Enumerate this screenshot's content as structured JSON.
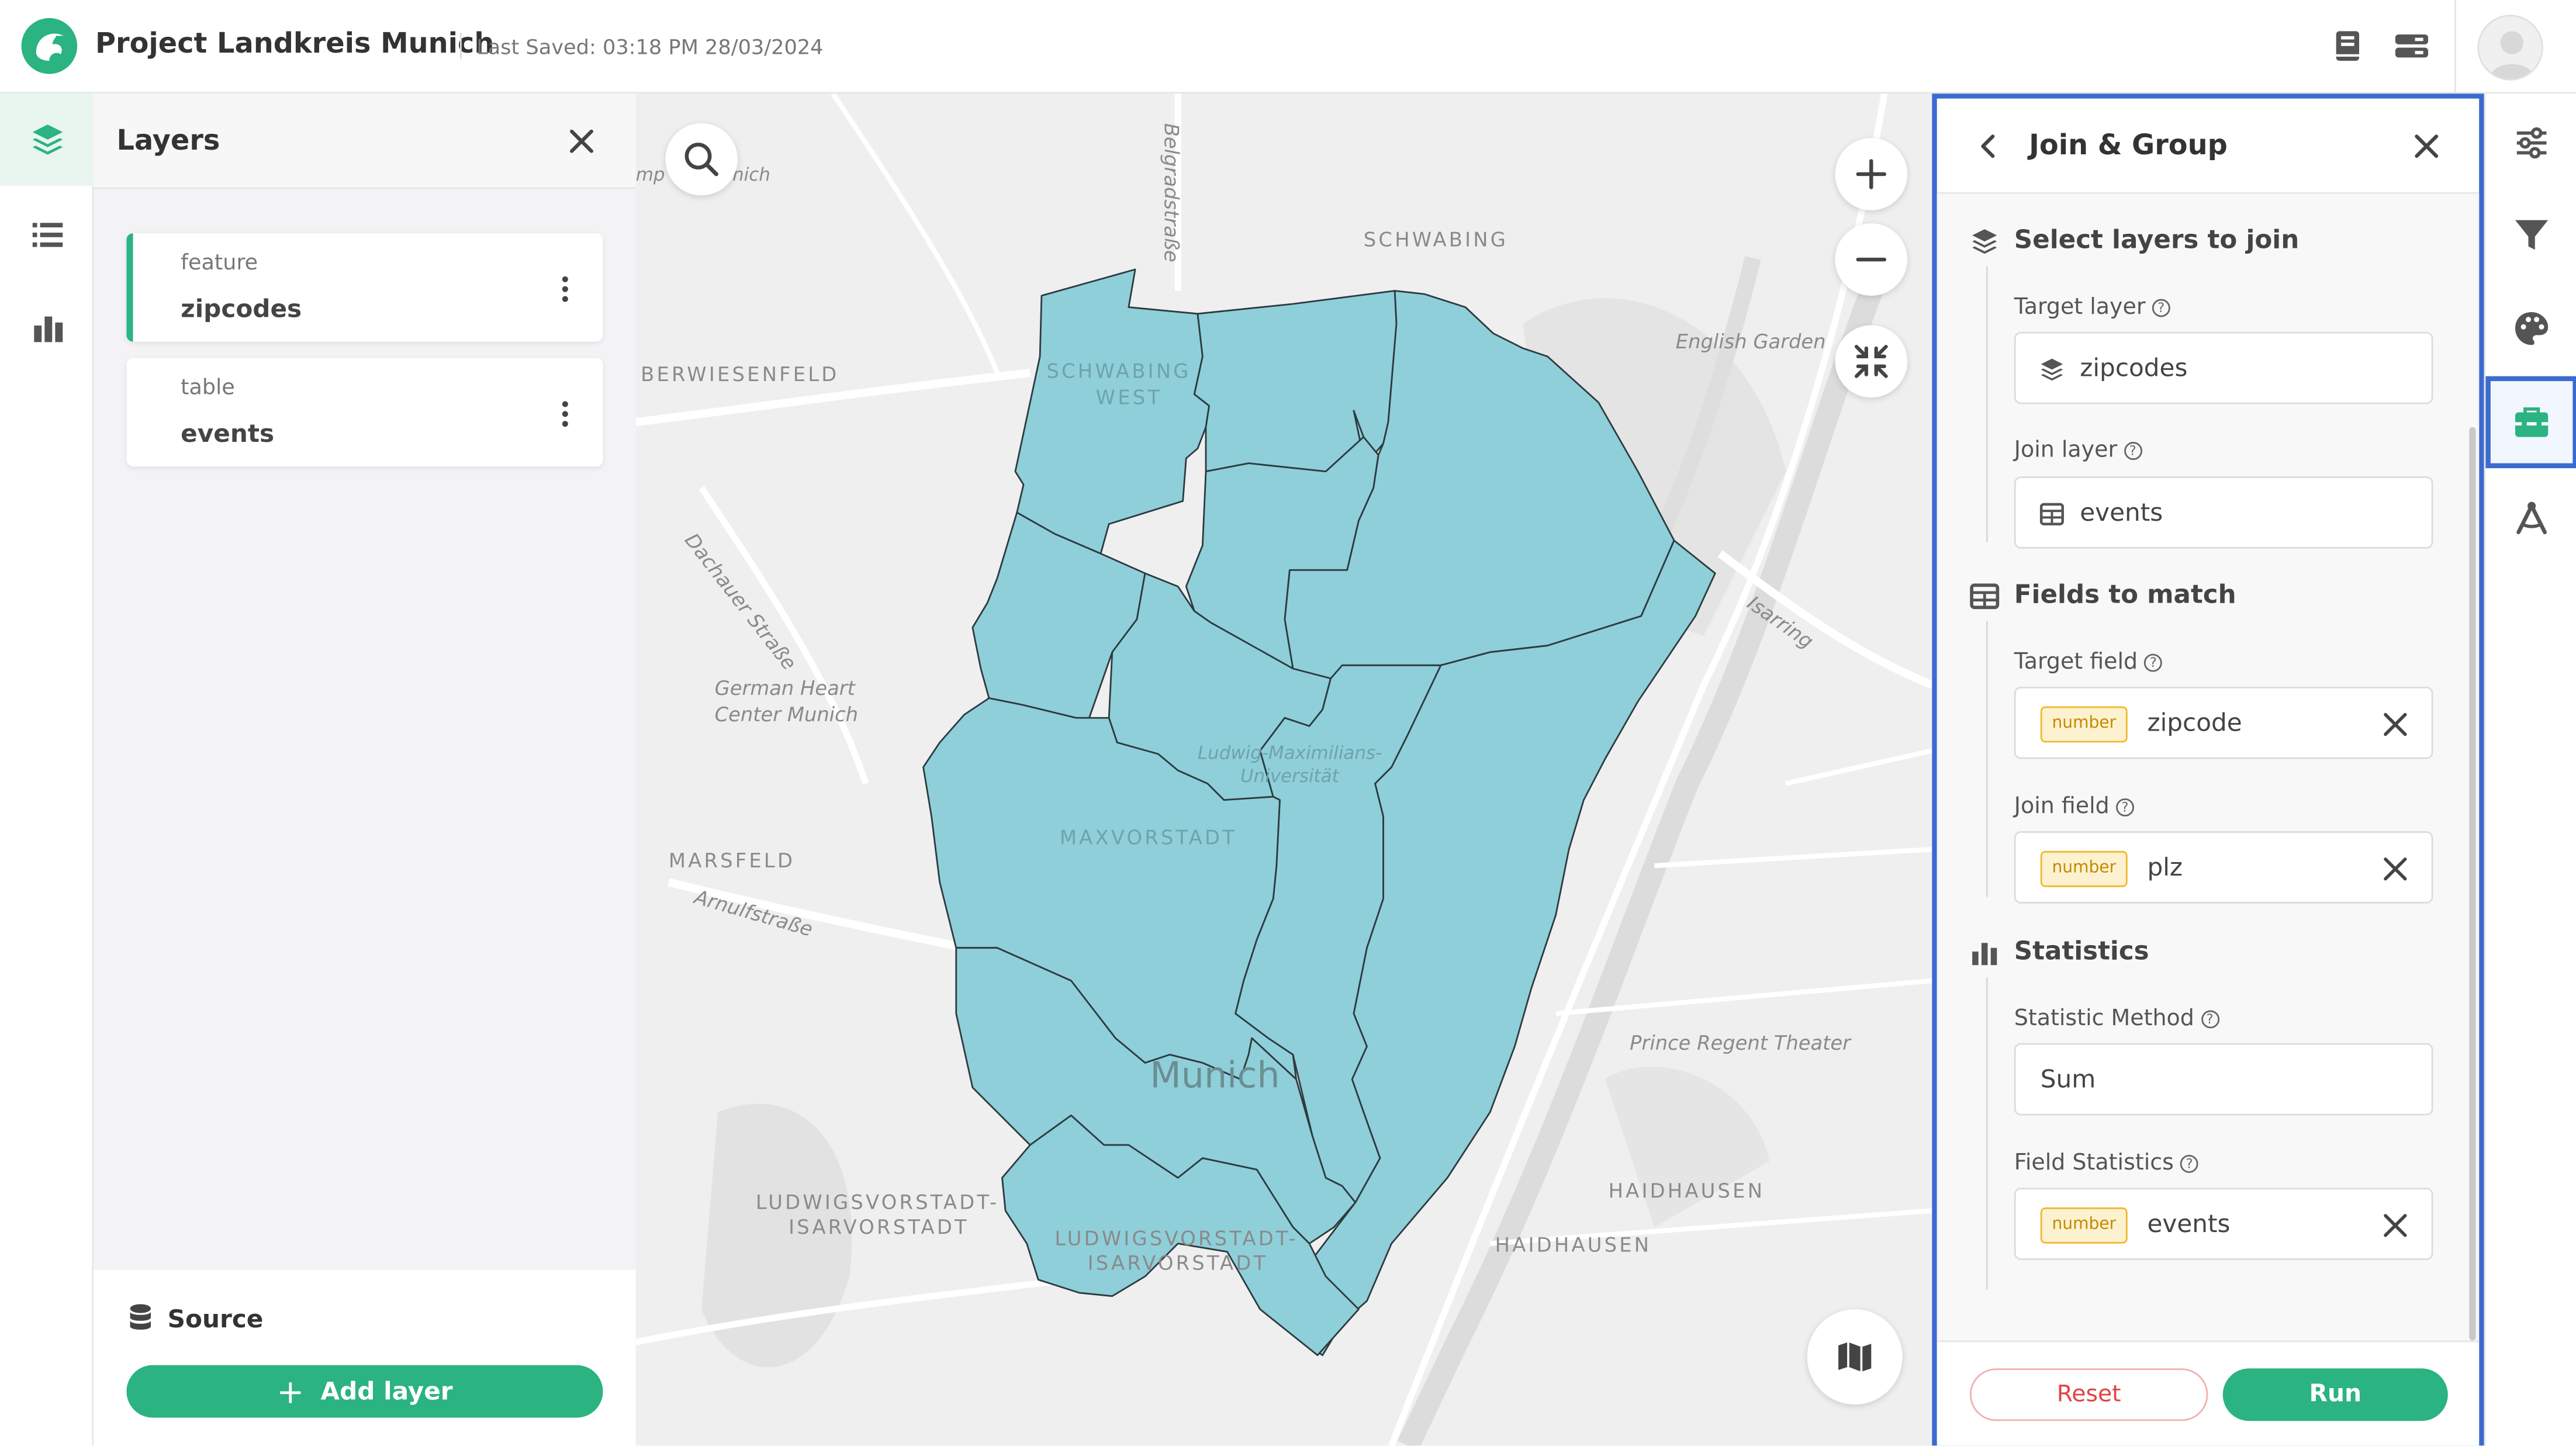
{
  "header": {
    "project_title": "Project Landkreis Munich",
    "last_saved": "Last Saved: 03:18 PM 28/03/2024",
    "icons": [
      "book-icon",
      "data-stack-icon",
      "user-avatar-icon"
    ]
  },
  "left_rail": {
    "items": [
      {
        "icon": "layers-icon",
        "active": true
      },
      {
        "icon": "list-icon",
        "active": false
      },
      {
        "icon": "bar-chart-icon",
        "active": false
      }
    ]
  },
  "layers_panel": {
    "title": "Layers",
    "layers": [
      {
        "type": "feature",
        "name": "zipcodes",
        "selected": true
      },
      {
        "type": "table",
        "name": "events",
        "selected": false
      }
    ],
    "source_label": "Source",
    "add_layer_label": "Add layer"
  },
  "map": {
    "labels": {
      "schwabing": "SCHWABING",
      "schwabing_west_1": "SCHWABING",
      "schwabing_west_2": "WEST",
      "berwiesenfeld": "BERWIESENFELD",
      "english_garden": "English Garden",
      "dachauer": "Dachauer Straße",
      "isarring": "Isarring",
      "belgradstrasse": "Belgradstraße",
      "german_heart_1": "German Heart",
      "german_heart_2": "Center Munich",
      "lmu_1": "Ludwig-Maximilians-",
      "lmu_2": "Universität",
      "maxvorstadt": "MAXVORSTADT",
      "marsfeld": "MARSFELD",
      "arnulfstrasse": "Arnulfstraße",
      "munich": "Munich",
      "prince_regent": "Prince Regent Theater",
      "haidhausen_1": "HAIDHAUSEN",
      "haidhausen_2": "HAIDHAUSEN",
      "ludwigsvorstadt_a1": "LUDWIGSVORSTADT-",
      "ludwigsvorstadt_a2": "ISARVORSTADT",
      "ludwigsvorstadt_b1": "LUDWIGSVORSTADT-",
      "ludwigsvorstadt_b2": "ISARVORSTADT",
      "museum": "mp      um Munich"
    },
    "polygon_fill": "#8fcfd9",
    "controls": [
      "search-icon",
      "zoom-in-icon",
      "zoom-out-icon",
      "fullscreen-exit-icon",
      "basemap-icon"
    ]
  },
  "tool_panel": {
    "title": "Join & Group",
    "sections": {
      "select_layers": "Select layers to join",
      "fields_to_match": "Fields to match",
      "statistics": "Statistics"
    },
    "target_layer": {
      "label": "Target layer",
      "value": "zipcodes"
    },
    "join_layer": {
      "label": "Join layer",
      "value": "events"
    },
    "target_field": {
      "label": "Target field",
      "type": "number",
      "value": "zipcode"
    },
    "join_field": {
      "label": "Join field",
      "type": "number",
      "value": "plz"
    },
    "statistic_method": {
      "label": "Statistic Method",
      "value": "Sum"
    },
    "field_statistics": {
      "label": "Field Statistics",
      "type": "number",
      "value": "events"
    },
    "reset_label": "Reset",
    "run_label": "Run"
  },
  "right_rail": {
    "items": [
      {
        "icon": "sliders-icon",
        "active": false
      },
      {
        "icon": "filter-icon",
        "active": false
      },
      {
        "icon": "palette-icon",
        "active": false
      },
      {
        "icon": "toolbox-icon",
        "active": true
      },
      {
        "icon": "drafting-compass-icon",
        "active": false
      }
    ]
  },
  "colors": {
    "accent_green": "#2bb381",
    "highlight_blue": "#3b6bd1",
    "badge_yellow": "#f2b82d",
    "reset_red": "#e04545"
  }
}
